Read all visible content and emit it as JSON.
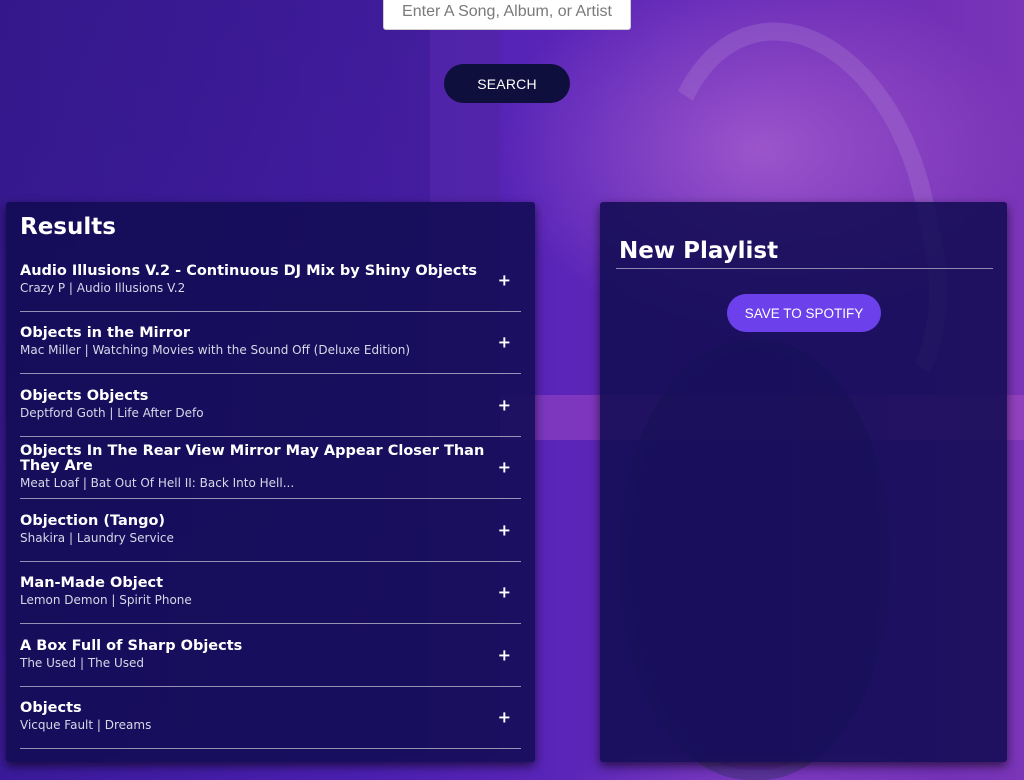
{
  "search": {
    "placeholder": "Enter A Song, Album, or Artist",
    "button_label": "SEARCH"
  },
  "results": {
    "title": "Results",
    "add_icon": "+",
    "tracks": [
      {
        "name": "Audio Illusions V.2 - Continuous DJ Mix by Shiny Objects",
        "meta": "Crazy P | Audio Illusions V.2"
      },
      {
        "name": "Objects in the Mirror",
        "meta": "Mac Miller | Watching Movies with the Sound Off (Deluxe Edition)"
      },
      {
        "name": "Objects Objects",
        "meta": "Deptford Goth | Life After Defo"
      },
      {
        "name": "Objects In The Rear View Mirror May Appear Closer Than They Are",
        "meta": "Meat Loaf | Bat Out Of Hell II: Back Into Hell..."
      },
      {
        "name": "Objection (Tango)",
        "meta": "Shakira | Laundry Service"
      },
      {
        "name": "Man-Made Object",
        "meta": "Lemon Demon | Spirit Phone"
      },
      {
        "name": "A Box Full of Sharp Objects",
        "meta": "The Used | The Used"
      },
      {
        "name": "Objects",
        "meta": "Vicque Fault | Dreams"
      }
    ]
  },
  "playlist": {
    "name": "New Playlist",
    "save_label": "SAVE TO SPOTIFY"
  },
  "colors": {
    "panel_bg": "#100c52",
    "search_button": "#0f0f3d",
    "save_button": "#6c41ec",
    "background_purple": "#4a1fb0"
  }
}
